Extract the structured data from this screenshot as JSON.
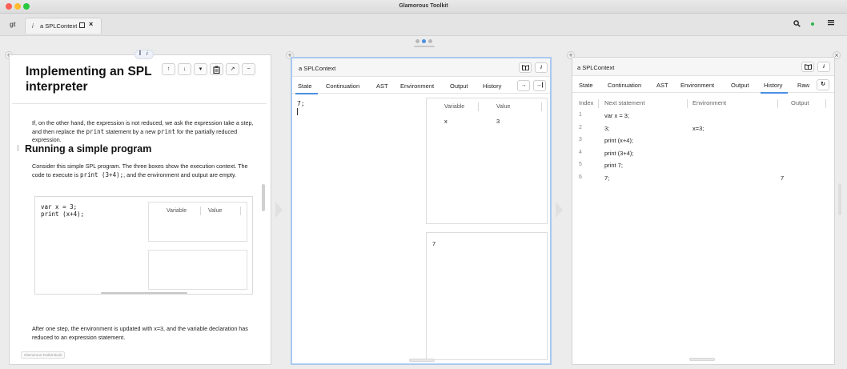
{
  "window": {
    "title": "Glamorous Toolkit"
  },
  "tabstrip": {
    "logo": "gt",
    "tab_icon": "i",
    "tab_label": "a SPLContext",
    "tab_close": "×",
    "icons": {
      "search": "search-icon",
      "status": "status-dot-icon",
      "menu": "menu-icon"
    },
    "status_color": "#2fb34a"
  },
  "pager": {
    "active_color": "#4a90e2",
    "inactive_color": "#b8b8b8"
  },
  "pane_controls": {
    "plus": "+",
    "close": "×"
  },
  "doc": {
    "title": "Implementing an SPL interpreter",
    "header_icons": {
      "edit": "Ī",
      "info": "i"
    },
    "para_1_pre": "If, on the other hand, the expression is not reduced, we ask the expression take a step, and then replace the ",
    "para_1_code_1": "print",
    "para_1_mid": " statement by a new ",
    "para_1_code_2": "print",
    "para_1_post": " for the partially reduced expression.",
    "heading_2": "Running a simple program",
    "para_2_pre": "Consider this simple SPL program. The three boxes show the execution context. The code to execute is ",
    "para_2_code": "print (3+4);",
    "para_2_post": ", and the environment and output are empty.",
    "embed_code": "var x = 3;\nprint (x+4);",
    "embed_col_variable": "Variable",
    "embed_col_value": "Value",
    "para_3": "After one step, the environment is updated with x=3, and the variable declaration has reduced to an expression statement.",
    "badge": "Glamorous Toolkit Book",
    "tools": [
      "↑",
      "↓",
      "▾",
      "clipboard-icon",
      "↗",
      "−"
    ]
  },
  "inspector1": {
    "title": "a SPLContext",
    "tabs": [
      "State",
      "Continuation",
      "AST",
      "Environment",
      "Output",
      "History"
    ],
    "active_tab": "State",
    "tab_buttons": [
      "→",
      "→|"
    ],
    "code": "7;",
    "vars_header": {
      "variable": "Variable",
      "value": "Value"
    },
    "vars_rows": [
      {
        "variable": "x",
        "value": "3"
      }
    ],
    "output": "7"
  },
  "inspector2": {
    "title": "a SPLContext",
    "tabs": [
      "State",
      "Continuation",
      "AST",
      "Environment",
      "Output",
      "History",
      "Raw"
    ],
    "active_tab": "History",
    "columns": {
      "index": "Index",
      "next": "Next statement",
      "env": "Environment",
      "output": "Output"
    },
    "rows": [
      {
        "index": "1",
        "next": "var x = 3;",
        "env": "",
        "output": ""
      },
      {
        "index": "2",
        "next": "3;",
        "env": "x=3;",
        "output": ""
      },
      {
        "index": "3",
        "next": "print (x+4);",
        "env": "",
        "output": ""
      },
      {
        "index": "4",
        "next": "print (3+4);",
        "env": "",
        "output": ""
      },
      {
        "index": "5",
        "next": "print 7;",
        "env": "",
        "output": ""
      },
      {
        "index": "6",
        "next": "7;",
        "env": "",
        "output": "7"
      }
    ]
  },
  "head_buttons": {
    "book": "book-icon",
    "info": "i",
    "refresh": "↻"
  }
}
